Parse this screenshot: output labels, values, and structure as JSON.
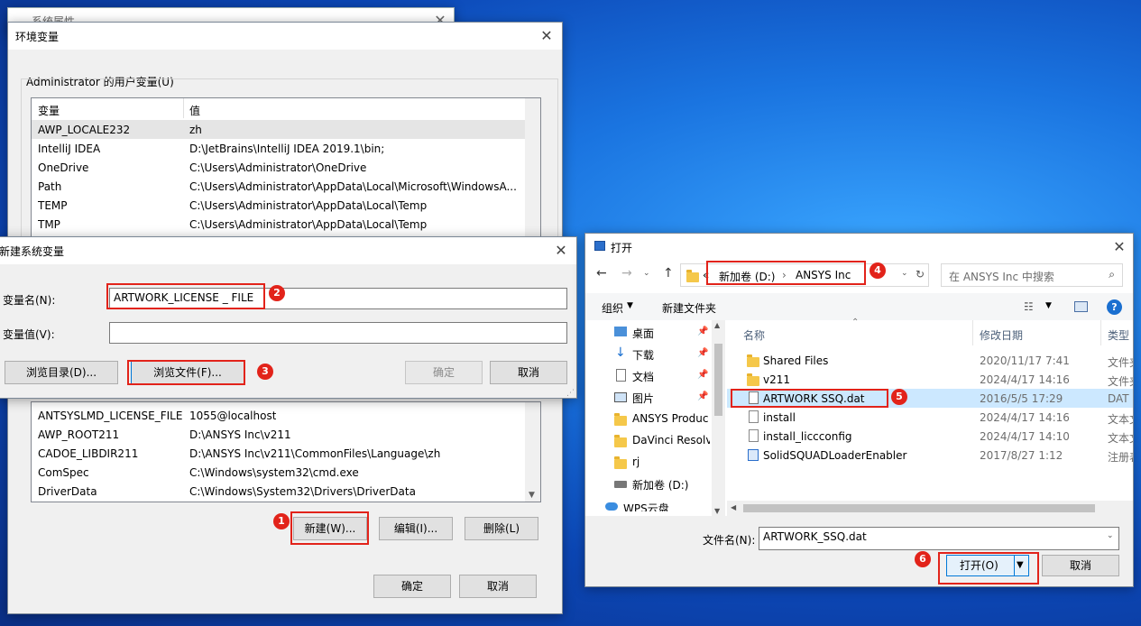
{
  "background_window": {
    "title": "系统属性"
  },
  "env_dialog": {
    "title": "环境变量",
    "user_section_label": "Administrator 的用户变量(U)",
    "col_var": "变量",
    "col_val": "值",
    "user_vars": [
      {
        "name": "AWP_LOCALE232",
        "value": "zh"
      },
      {
        "name": "IntelliJ IDEA",
        "value": "D:\\JetBrains\\IntelliJ IDEA 2019.1\\bin;"
      },
      {
        "name": "OneDrive",
        "value": "C:\\Users\\Administrator\\OneDrive"
      },
      {
        "name": "Path",
        "value": "C:\\Users\\Administrator\\AppData\\Local\\Microsoft\\WindowsA..."
      },
      {
        "name": "TEMP",
        "value": "C:\\Users\\Administrator\\AppData\\Local\\Temp"
      },
      {
        "name": "TMP",
        "value": "C:\\Users\\Administrator\\AppData\\Local\\Temp"
      }
    ],
    "system_vars": [
      {
        "name": "ANTSYSLMD_LICENSE_FILE",
        "value": "1055@localhost"
      },
      {
        "name": "AWP_ROOT211",
        "value": "D:\\ANSYS Inc\\v211"
      },
      {
        "name": "CADOE_LIBDIR211",
        "value": "D:\\ANSYS Inc\\v211\\CommonFiles\\Language\\zh"
      },
      {
        "name": "ComSpec",
        "value": "C:\\Windows\\system32\\cmd.exe"
      },
      {
        "name": "DriverData",
        "value": "C:\\Windows\\System32\\Drivers\\DriverData"
      }
    ],
    "new_button": "新建(W)...",
    "edit_button": "编辑(I)...",
    "delete_button": "删除(L)",
    "ok_button": "确定",
    "cancel_button": "取消"
  },
  "new_var_dialog": {
    "title": "新建系统变量",
    "name_label": "变量名(N):",
    "name_value": "ARTWORK_LICENSE _ FILE",
    "value_label": "变量值(V):",
    "value_value": "",
    "browse_dir": "浏览目录(D)...",
    "browse_file": "浏览文件(F)...",
    "ok": "确定",
    "cancel": "取消"
  },
  "open_dialog": {
    "title": "打开",
    "breadcrumb_prefix": "«",
    "breadcrumb": [
      "新加卷 (D:)",
      "ANSYS Inc"
    ],
    "search_placeholder": "在 ANSYS Inc 中搜索",
    "organize": "组织",
    "new_folder": "新建文件夹",
    "headers": {
      "name": "名称",
      "date": "修改日期",
      "type": "类型"
    },
    "nav_items": [
      {
        "label": "桌面",
        "icon": "desktop-icon",
        "pinned": true
      },
      {
        "label": "下载",
        "icon": "download-icon",
        "pinned": true
      },
      {
        "label": "文档",
        "icon": "document-icon",
        "pinned": true
      },
      {
        "label": "图片",
        "icon": "picture-icon",
        "pinned": true
      },
      {
        "label": "ANSYS Produc",
        "icon": "folder-icon",
        "pinned": false
      },
      {
        "label": "DaVinci Resolv",
        "icon": "folder-icon",
        "pinned": false
      },
      {
        "label": "rj",
        "icon": "folder-icon",
        "pinned": false
      },
      {
        "label": "新加卷 (D:)",
        "icon": "drive-icon",
        "pinned": false
      },
      {
        "label": "WPS云盘",
        "icon": "cloud-icon",
        "pinned": false
      }
    ],
    "files": [
      {
        "name": "Shared Files",
        "date": "2020/11/17 7:41",
        "type": "文件夹",
        "icon": "folder-icon",
        "selected": false
      },
      {
        "name": "v211",
        "date": "2024/4/17 14:16",
        "type": "文件夹",
        "icon": "folder-icon",
        "selected": false
      },
      {
        "name": "ARTWORK SSQ.dat",
        "date": "2016/5/5 17:29",
        "type": "DAT",
        "icon": "file-icon",
        "selected": true
      },
      {
        "name": "install",
        "date": "2024/4/17 14:16",
        "type": "文本文",
        "icon": "text-file-icon",
        "selected": false
      },
      {
        "name": "install_liccconfig",
        "date": "2024/4/17 14:10",
        "type": "文本文",
        "icon": "text-file-icon",
        "selected": false
      },
      {
        "name": "SolidSQUADLoaderEnabler",
        "date": "2017/8/27 1:12",
        "type": "注册表",
        "icon": "registry-icon",
        "selected": false
      }
    ],
    "filename_label": "文件名(N):",
    "filename_value": "ARTWORK_SSQ.dat",
    "open_button": "打开(O)",
    "cancel_button": "取消"
  },
  "annotations": [
    "1",
    "2",
    "3",
    "4",
    "5",
    "6"
  ],
  "colors": {
    "highlight": "#e2231a",
    "accent": "#0078d7",
    "selection": "#cce8ff"
  }
}
